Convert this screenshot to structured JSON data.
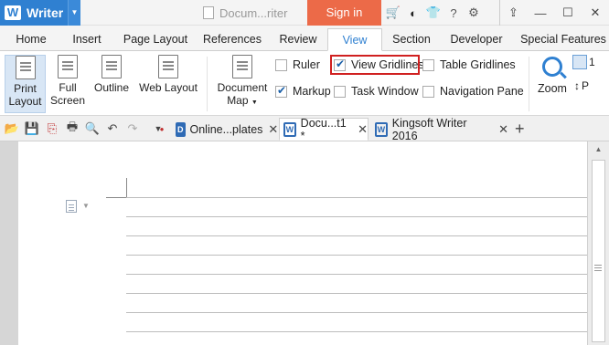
{
  "title_bar": {
    "app_name": "Writer",
    "document_title": "Docum...riter",
    "sign_in_label": "Sign in",
    "icons": [
      "cart-icon",
      "skin-icon",
      "shirt-icon",
      "help-icon",
      "settings-icon"
    ],
    "window_controls": [
      "restore-up-icon",
      "minimize-icon",
      "maximize-icon",
      "close-icon"
    ]
  },
  "menu_tabs": [
    {
      "label": "Home",
      "active": false
    },
    {
      "label": "Insert",
      "active": false
    },
    {
      "label": "Page Layout",
      "active": false
    },
    {
      "label": "References",
      "active": false
    },
    {
      "label": "Review",
      "active": false
    },
    {
      "label": "View",
      "active": true
    },
    {
      "label": "Section",
      "active": false
    },
    {
      "label": "Developer",
      "active": false
    },
    {
      "label": "Special Features",
      "active": false
    }
  ],
  "ribbon": {
    "print_layout_line1": "Print",
    "print_layout_line2": "Layout",
    "full_screen_line1": "Full",
    "full_screen_line2": "Screen",
    "outline": "Outline",
    "web_layout": "Web Layout",
    "document_map_line1": "Document",
    "document_map_line2": "Map",
    "checkboxes": {
      "ruler": {
        "label": "Ruler",
        "checked": false
      },
      "view_gridlines": {
        "label": "View Gridlines",
        "checked": true
      },
      "table_gridlines": {
        "label": "Table Gridlines",
        "checked": false
      },
      "markup": {
        "label": "Markup",
        "checked": true
      },
      "task_window": {
        "label": "Task Window",
        "checked": false
      },
      "navigation_pane": {
        "label": "Navigation Pane",
        "checked": false
      }
    },
    "zoom": "Zoom",
    "zoom_side_top": "1",
    "zoom_side_bottom": "P"
  },
  "doc_tabs": [
    {
      "label": "Online...plates",
      "active": false
    },
    {
      "label": "Docu...t1 *",
      "active": true
    },
    {
      "label": "Kingsoft Writer 2016",
      "active": false
    }
  ],
  "colors": {
    "accent": "#2f80d1",
    "sign_in": "#ec6a48",
    "highlight": "#d02020"
  }
}
